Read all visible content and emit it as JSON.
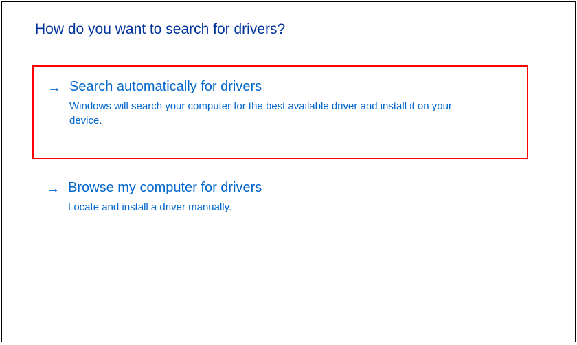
{
  "header": {
    "title": "How do you want to search for drivers?"
  },
  "options": [
    {
      "title": "Search automatically for drivers",
      "description": "Windows will search your computer for the best available driver and install it on your device."
    },
    {
      "title": "Browse my computer for drivers",
      "description": "Locate and install a driver manually."
    }
  ]
}
